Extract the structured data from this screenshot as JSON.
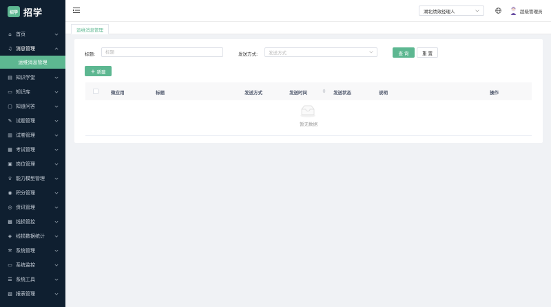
{
  "app": {
    "logo_mark": "招学",
    "logo_text": "招学"
  },
  "sidebar": {
    "items": [
      {
        "label": "首页",
        "icon": "home-icon"
      },
      {
        "label": "消息管理",
        "icon": "bell-icon",
        "open": true
      },
      {
        "label": "知识学堂",
        "icon": "book-icon"
      },
      {
        "label": "知识库",
        "icon": "folder-icon"
      },
      {
        "label": "知道问答",
        "icon": "qa-icon"
      },
      {
        "label": "试题管理",
        "icon": "edit-icon"
      },
      {
        "label": "试卷管理",
        "icon": "paper-icon"
      },
      {
        "label": "考试管理",
        "icon": "exam-icon"
      },
      {
        "label": "岗位管理",
        "icon": "post-icon"
      },
      {
        "label": "能力模型管理",
        "icon": "trophy-icon"
      },
      {
        "label": "积分管理",
        "icon": "points-icon"
      },
      {
        "label": "资讯管理",
        "icon": "news-icon"
      },
      {
        "label": "线损管控",
        "icon": "control-icon"
      },
      {
        "label": "线损数据统计",
        "icon": "stats-icon"
      },
      {
        "label": "系统管理",
        "icon": "gear-icon"
      },
      {
        "label": "系统监控",
        "icon": "monitor-icon"
      },
      {
        "label": "系统工具",
        "icon": "tools-icon"
      },
      {
        "label": "报表管理",
        "icon": "report-icon"
      }
    ],
    "active_sub": "运维消息管理"
  },
  "header": {
    "org_select": "湖北绩效经理人",
    "user_name": "超级管理员"
  },
  "tabs": [
    {
      "label": "运维消息管理"
    }
  ],
  "search": {
    "title_label": "标题:",
    "title_placeholder": "标题",
    "method_label": "发送方式:",
    "method_placeholder": "发送方式",
    "query_btn": "查 询",
    "reset_btn": "重 置"
  },
  "toolbar": {
    "add_btn": "新建"
  },
  "table": {
    "columns": [
      "微应用",
      "标题",
      "发送方式",
      "发送时间",
      "发送状态",
      "说明",
      "操作"
    ],
    "empty_text": "暂无数据"
  },
  "colors": {
    "accent": "#5db791",
    "sidebar_bg": "#0f1f30"
  }
}
